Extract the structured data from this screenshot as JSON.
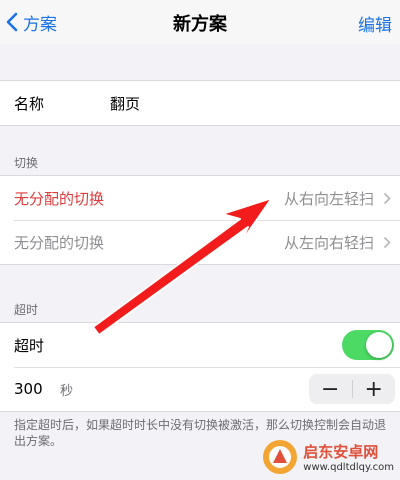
{
  "navbar": {
    "back_label": "方案",
    "title": "新方案",
    "edit_label": "编辑"
  },
  "name_row": {
    "label": "名称",
    "value": "翻页"
  },
  "switch_section": {
    "header": "切换",
    "rows": [
      {
        "label": "无分配的切换",
        "value": "从右向左轻扫"
      },
      {
        "label": "无分配的切换",
        "value": "从左向右轻扫"
      }
    ]
  },
  "timeout_section": {
    "header": "超时",
    "toggle_label": "超时",
    "toggle_on": true,
    "value": "300",
    "unit": "秒",
    "minus": "−",
    "plus": "+"
  },
  "footer_note": "指定超时后，如果超时时长中没有切换被激活，那么切换控制会自动退出方案。",
  "colors": {
    "accent": "#1a73e8",
    "toggle_on": "#4cd964",
    "highlight_red": "#e03b3b",
    "arrow": "#f21c1c"
  },
  "watermark": {
    "title": "启东安卓网",
    "url": "www.qdltdlqy.com"
  }
}
